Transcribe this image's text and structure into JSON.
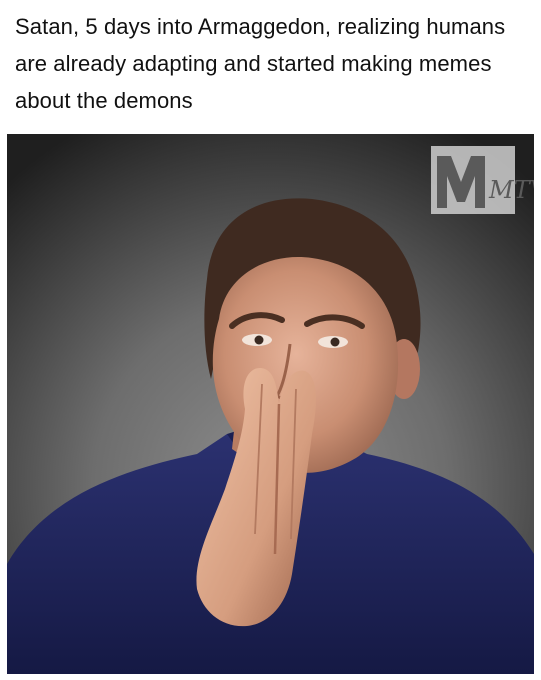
{
  "caption": {
    "text": "Satan, 5 days into Armaggedon, realizing humans are already adapting and started making memes about the demons"
  },
  "photo": {
    "logo_text": "MTV",
    "background_color": "#6a6a6a",
    "jacket_color": "#22285e"
  }
}
